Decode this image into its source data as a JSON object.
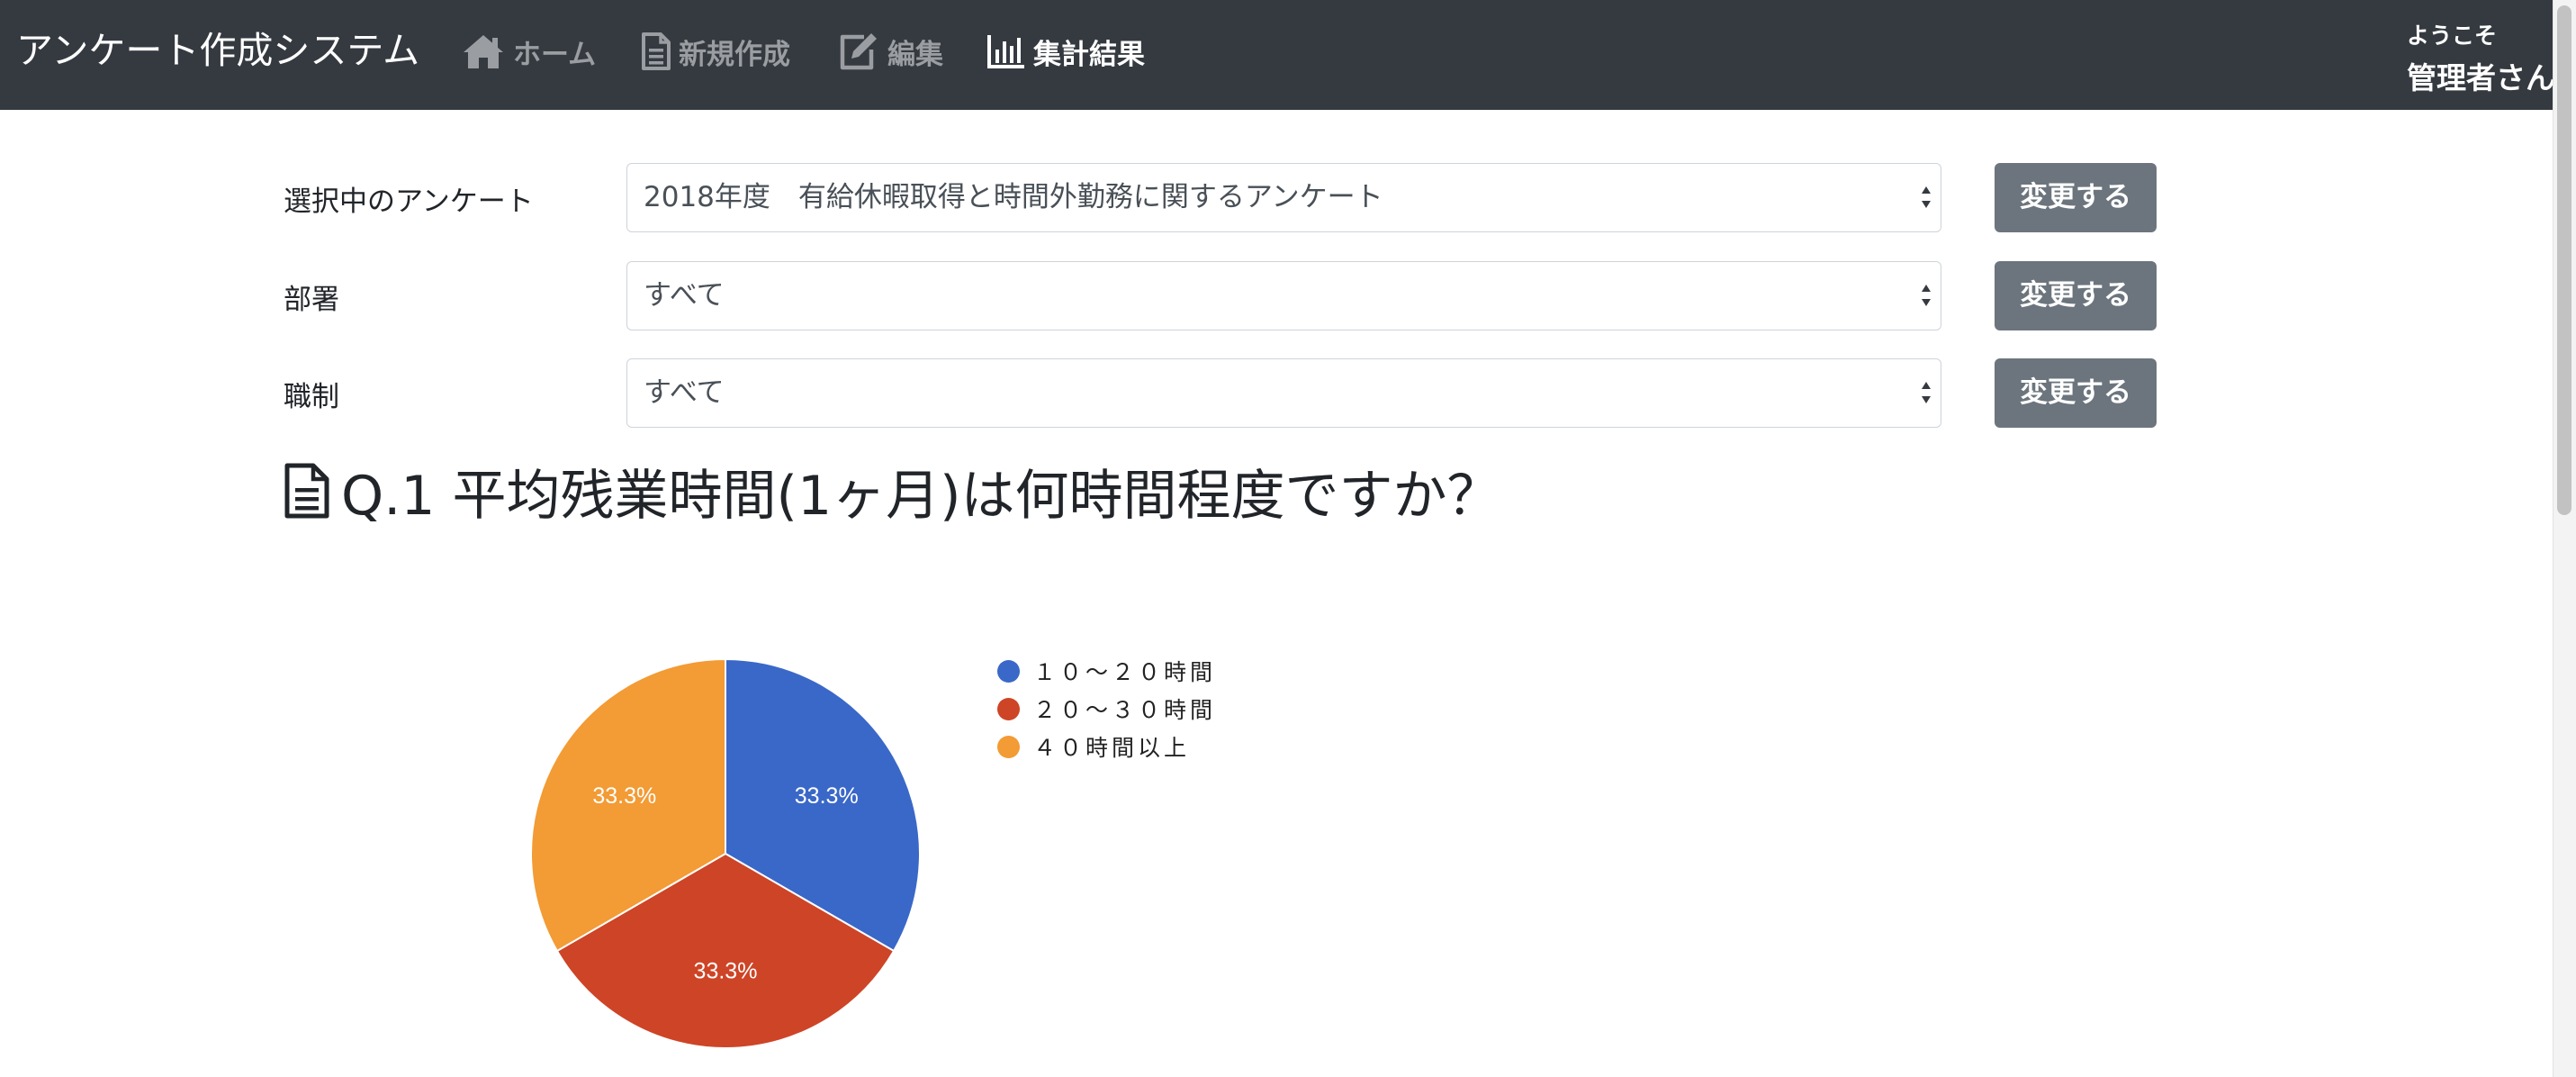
{
  "app": {
    "brand": "アンケート作成システム",
    "welcome": "ようこそ",
    "username": "管理者さん"
  },
  "nav": {
    "home": "ホーム",
    "new": "新規作成",
    "edit": "編集",
    "results": "集計結果"
  },
  "filters": [
    {
      "label": "選択中のアンケート",
      "value": "2018年度　有給休暇取得と時間外勤務に関するアンケート",
      "button": "変更する"
    },
    {
      "label": "部署",
      "value": "すべて",
      "button": "変更する"
    },
    {
      "label": "職制",
      "value": "すべて",
      "button": "変更する"
    }
  ],
  "question": {
    "title": "Q.1 平均残業時間(1ヶ月)は何時間程度ですか？"
  },
  "colors": {
    "navbar": "#343a40",
    "button": "#6c757d",
    "series": [
      "#3a68c8",
      "#ce4426",
      "#f39b34"
    ]
  },
  "chart_data": {
    "type": "pie",
    "categories": [
      "１０〜２０時間",
      "２０〜３０時間",
      "４０時間以上"
    ],
    "values": [
      33.3,
      33.3,
      33.3
    ],
    "labels": [
      "33.3%",
      "33.3%",
      "33.3%"
    ],
    "legend": "right",
    "title": ""
  }
}
